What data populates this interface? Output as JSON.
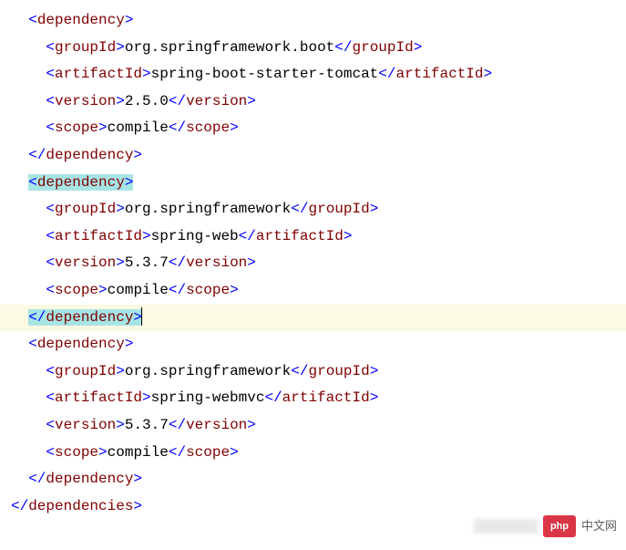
{
  "lines": [
    {
      "indent": 1,
      "type": "open",
      "tag": "dependency"
    },
    {
      "indent": 2,
      "type": "full",
      "tag": "groupId",
      "text": "org.springframework.boot"
    },
    {
      "indent": 2,
      "type": "full",
      "tag": "artifactId",
      "text": "spring-boot-starter-tomcat"
    },
    {
      "indent": 2,
      "type": "full",
      "tag": "version",
      "text": "2.5.0"
    },
    {
      "indent": 2,
      "type": "full",
      "tag": "scope",
      "text": "compile"
    },
    {
      "indent": 1,
      "type": "close",
      "tag": "dependency"
    },
    {
      "indent": 1,
      "type": "open",
      "tag": "dependency",
      "highlight": true
    },
    {
      "indent": 2,
      "type": "full",
      "tag": "groupId",
      "text": "org.springframework"
    },
    {
      "indent": 2,
      "type": "full",
      "tag": "artifactId",
      "text": "spring-web"
    },
    {
      "indent": 2,
      "type": "full",
      "tag": "version",
      "text": "5.3.7"
    },
    {
      "indent": 2,
      "type": "full",
      "tag": "scope",
      "text": "compile"
    },
    {
      "indent": 1,
      "type": "close",
      "tag": "dependency",
      "highlight": true,
      "currentLine": true,
      "cursor": true
    },
    {
      "indent": 1,
      "type": "open",
      "tag": "dependency"
    },
    {
      "indent": 2,
      "type": "full",
      "tag": "groupId",
      "text": "org.springframework"
    },
    {
      "indent": 2,
      "type": "full",
      "tag": "artifactId",
      "text": "spring-webmvc"
    },
    {
      "indent": 2,
      "type": "full",
      "tag": "version",
      "text": "5.3.7"
    },
    {
      "indent": 2,
      "type": "full",
      "tag": "scope",
      "text": "compile"
    },
    {
      "indent": 1,
      "type": "close",
      "tag": "dependency"
    },
    {
      "indent": 0,
      "type": "close",
      "tag": "dependencies"
    }
  ],
  "watermark": {
    "badge": "php",
    "text": "中文网"
  }
}
